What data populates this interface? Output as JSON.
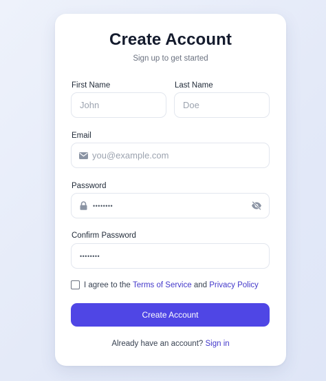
{
  "header": {
    "title": "Create Account",
    "subtitle": "Sign up to get started"
  },
  "form": {
    "first_name": {
      "label": "First Name",
      "placeholder": "John",
      "value": ""
    },
    "last_name": {
      "label": "Last Name",
      "placeholder": "Doe",
      "value": ""
    },
    "email": {
      "label": "Email",
      "placeholder": "you@example.com",
      "value": "",
      "icon": "envelope-icon"
    },
    "password": {
      "label": "Password",
      "masked_value": "••••••••",
      "icon": "lock-icon",
      "toggle_icon": "eye-slash-icon"
    },
    "confirm_password": {
      "label": "Confirm Password",
      "masked_value": "••••••••"
    },
    "terms": {
      "prefix": "I agree to the",
      "terms_link": "Terms of Service",
      "middle": "and",
      "privacy_link": "Privacy Policy",
      "checked": false
    },
    "submit_label": "Create Account"
  },
  "footer": {
    "prompt": "Already have an account?",
    "signin_link": "Sign in"
  },
  "colors": {
    "accent": "#4f46e5",
    "link": "#4338ca",
    "title": "#141b2d",
    "muted": "#6b7280"
  }
}
